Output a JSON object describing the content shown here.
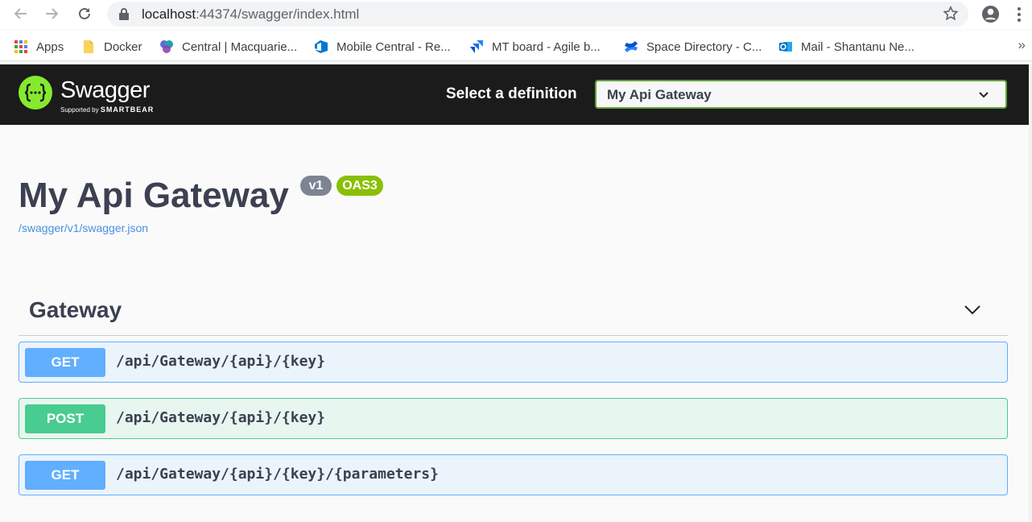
{
  "browser": {
    "url_host": "localhost",
    "url_rest": ":44374/swagger/index.html",
    "bookmarks": [
      {
        "label": "Apps",
        "icon": "apps-grid-icon"
      },
      {
        "label": "Docker",
        "icon": "folder-icon"
      },
      {
        "label": "Central | Macquarie...",
        "icon": "central-logo-icon"
      },
      {
        "label": "Mobile Central - Re...",
        "icon": "azure-devops-icon"
      },
      {
        "label": "MT board - Agile b...",
        "icon": "jira-icon"
      },
      {
        "label": "Space Directory - C...",
        "icon": "confluence-icon"
      },
      {
        "label": "Mail - Shantanu Ne...",
        "icon": "outlook-icon"
      }
    ],
    "more_label": "»"
  },
  "swagger_header": {
    "logo_text": "Swagger",
    "logo_sub_prefix": "Supported by ",
    "logo_sub_brand": "SMARTBEAR",
    "definition_label": "Select a definition",
    "definition_selected": "My Api Gateway"
  },
  "info": {
    "title": "My Api Gateway",
    "version_badge": "v1",
    "oas_badge": "OAS3",
    "spec_link": "/swagger/v1/swagger.json"
  },
  "tag": {
    "name": "Gateway"
  },
  "operations": [
    {
      "method": "GET",
      "path": "/api/Gateway/{api}/{key}"
    },
    {
      "method": "POST",
      "path": "/api/Gateway/{api}/{key}"
    },
    {
      "method": "GET",
      "path": "/api/Gateway/{api}/{key}/{parameters}"
    }
  ],
  "colors": {
    "get": "#61affe",
    "post": "#49cc90",
    "header_bg": "#1b1b1b",
    "swagger_green": "#85ea2d",
    "oas_badge": "#89bf04",
    "version_badge": "#7d8492"
  }
}
